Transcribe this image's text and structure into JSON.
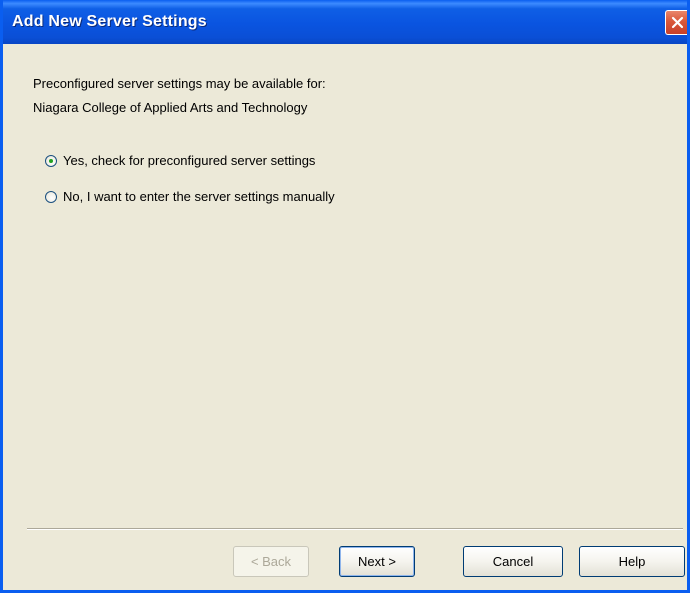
{
  "window": {
    "title": "Add New Server Settings",
    "close_icon": "close-icon"
  },
  "main": {
    "intro_line1": "Preconfigured server settings may be available for:",
    "intro_line2": "Niagara College of Applied Arts and Technology",
    "options": [
      {
        "label": "Yes, check for preconfigured server settings",
        "checked": true
      },
      {
        "label": "No, I want to enter the server settings manually",
        "checked": false
      }
    ]
  },
  "buttons": {
    "back": "< Back",
    "back_enabled": false,
    "next": "Next >",
    "cancel": "Cancel",
    "help": "Help"
  },
  "colors": {
    "titlebar": "#0a54e0",
    "background": "#ece9d8",
    "close_button": "#d9583a"
  }
}
